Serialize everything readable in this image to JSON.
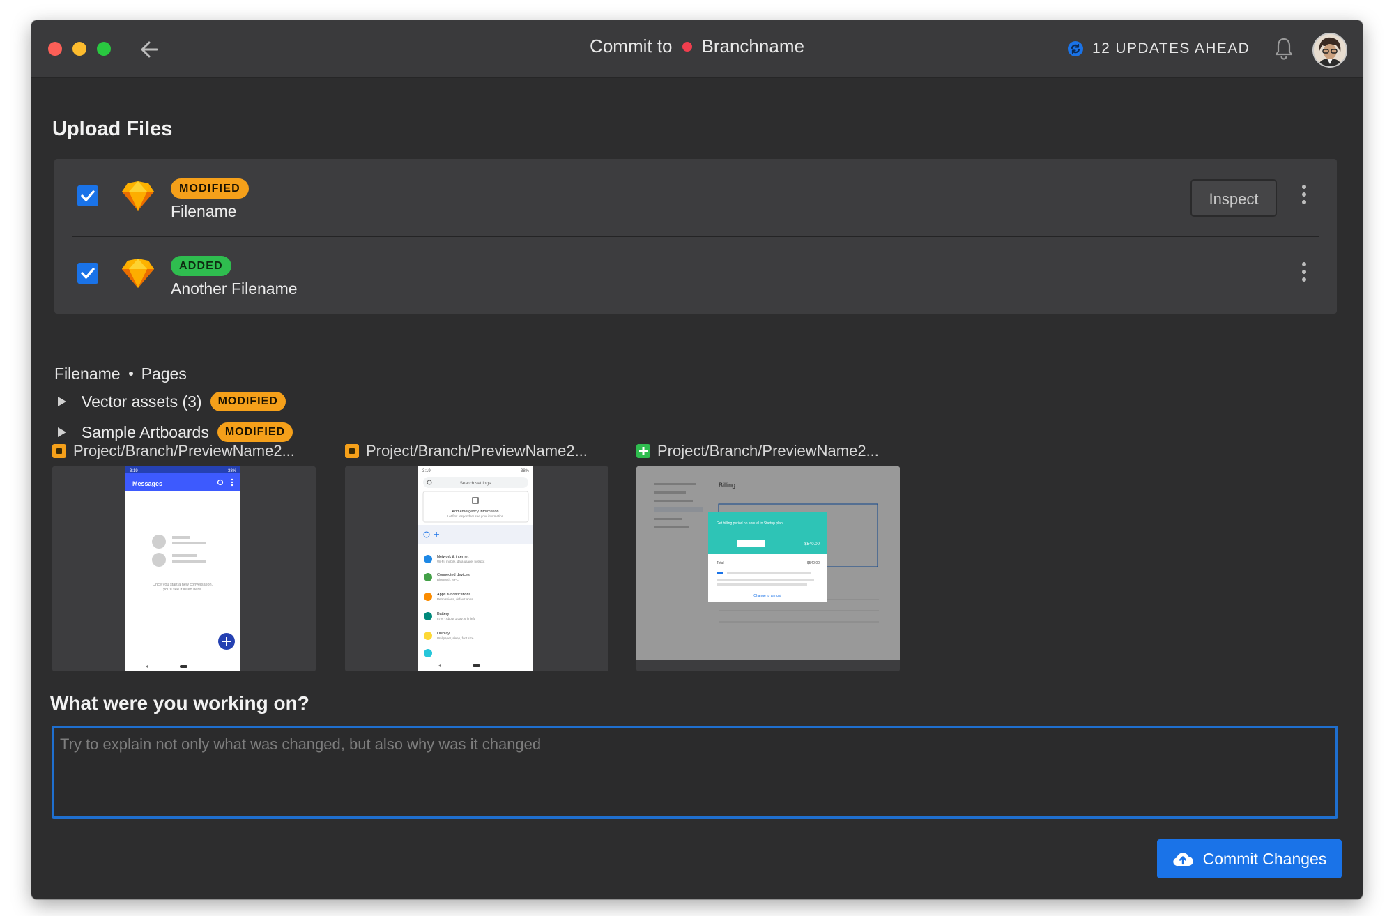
{
  "titlebar": {
    "title_prefix": "Commit to",
    "branch_name": "Branchname",
    "branch_dot_color": "#f03e4e",
    "updates_text": "12 UPDATES AHEAD",
    "updates_icon": "sync-icon",
    "notification_icon": "bell-icon"
  },
  "upload": {
    "heading": "Upload Files",
    "files": [
      {
        "status": "MODIFIED",
        "name": "Filename",
        "checked": true,
        "icon": "sketch-icon",
        "action": "Inspect"
      },
      {
        "status": "ADDED",
        "name": "Another Filename",
        "checked": true,
        "icon": "sketch-icon"
      }
    ]
  },
  "breadcrumb": {
    "file": "Filename",
    "section": "Pages"
  },
  "tree": [
    {
      "label": "Vector assets (3)",
      "status": "MODIFIED",
      "expanded": false
    },
    {
      "label": "Sample Artboards",
      "status": "MODIFIED",
      "expanded": false
    }
  ],
  "previews": [
    {
      "label": "Project/Branch/PreviewName2...",
      "status_icon": "modified-square-icon"
    },
    {
      "label": "Project/Branch/PreviewName2...",
      "status_icon": "modified-square-icon"
    },
    {
      "label": "Project/Branch/PreviewName2...",
      "status_icon": "added-plus-icon"
    }
  ],
  "thumbs": {
    "messages": {
      "time": "3:19",
      "battery": "38%",
      "title": "Messages",
      "empty_line1": "Once you start a new conversation,",
      "empty_line2": "you'll see it listed here."
    },
    "settings": {
      "time": "3:19",
      "battery": "38%",
      "search": "Search settings",
      "card_title": "Add emergency information",
      "card_sub": "Let first responders see your information",
      "items": [
        {
          "title": "Network & internet",
          "sub": "Wi-Fi, mobile, data usage, hotspot",
          "color": "#1e88e5"
        },
        {
          "title": "Connected devices",
          "sub": "Bluetooth, NFC",
          "color": "#43a047"
        },
        {
          "title": "Apps & notifications",
          "sub": "Permissions, default apps",
          "color": "#fb8c00"
        },
        {
          "title": "Battery",
          "sub": "87% · About 1 day, 6 hr left",
          "color": "#00897b"
        },
        {
          "title": "Display",
          "sub": "Wallpaper, sleep, font size",
          "color": "#fdd835"
        }
      ]
    },
    "billing": {
      "title": "Billing",
      "modal_title": "Get billing period on annual to Startup plan",
      "amount": "$540.00",
      "total_label": "Total",
      "total_amount": "$540.00",
      "link": "Change to annual"
    }
  },
  "message": {
    "heading": "What were you working on?",
    "placeholder": "Try to explain not only what was changed, but also why was it changed",
    "value": ""
  },
  "commit": {
    "label": "Commit Changes",
    "icon": "cloud-upload-icon"
  },
  "colors": {
    "accent": "#1a73e8",
    "modified": "#f5a01a",
    "added": "#2fbd4f",
    "background": "#2d2d2e"
  }
}
